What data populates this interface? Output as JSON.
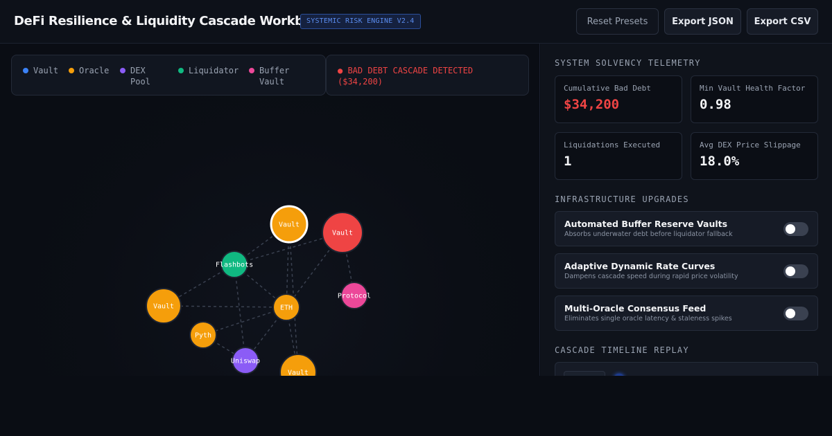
{
  "header": {
    "title": "DeFi Resilience & Liquidity Cascade Workbench",
    "badge": "SYSTEMIC RISK ENGINE V2.4",
    "buttons": {
      "reset": "Reset Presets",
      "export_json": "Export JSON",
      "export_csv": "Export CSV"
    }
  },
  "legend": {
    "items": [
      {
        "label": "Vault",
        "color": "#3b82f6"
      },
      {
        "label": "Oracle",
        "color": "#f59e0b"
      },
      {
        "label": "DEX\nPool",
        "color": "#8b5cf6"
      },
      {
        "label": "Liquidator",
        "color": "#10b981"
      },
      {
        "label": "Buffer\nVault",
        "color": "#ec4899"
      }
    ]
  },
  "alert": {
    "text": "● BAD DEBT CASCADE DETECTED ($34,200)",
    "color": "#ef4444"
  },
  "graph": {
    "nodes": [
      {
        "id": "vault-top",
        "label": "Vault",
        "color": "#f59e0b",
        "highlighted": true
      },
      {
        "id": "vault-red",
        "label": "Vault",
        "color": "#ef4444",
        "highlighted": false
      },
      {
        "id": "flashbots",
        "label": "Flashbots",
        "color": "#10b981",
        "highlighted": false
      },
      {
        "id": "protocol",
        "label": "Protocol",
        "color": "#ec4899",
        "highlighted": false
      },
      {
        "id": "vault-left",
        "label": "Vault",
        "color": "#f59e0b",
        "highlighted": false
      },
      {
        "id": "eth",
        "label": "ETH",
        "color": "#f59e0b",
        "highlighted": false
      },
      {
        "id": "pyth",
        "label": "Pyth",
        "color": "#f59e0b",
        "highlighted": false
      },
      {
        "id": "uniswap",
        "label": "Uniswap",
        "color": "#8b5cf6",
        "highlighted": false
      },
      {
        "id": "vault-bottom",
        "label": "Vault",
        "color": "#f59e0b",
        "highlighted": false
      }
    ],
    "edges": [
      [
        "flashbots",
        "vault-top"
      ],
      [
        "flashbots",
        "vault-red"
      ],
      [
        "flashbots",
        "vault-left"
      ],
      [
        "flashbots",
        "eth"
      ],
      [
        "flashbots",
        "uniswap"
      ],
      [
        "vault-top",
        "eth"
      ],
      [
        "vault-top",
        "vault-bottom"
      ],
      [
        "vault-red",
        "eth"
      ],
      [
        "vault-red",
        "protocol"
      ],
      [
        "vault-left",
        "eth"
      ],
      [
        "eth",
        "pyth"
      ],
      [
        "eth",
        "uniswap"
      ],
      [
        "eth",
        "vault-bottom"
      ],
      [
        "pyth",
        "uniswap"
      ]
    ]
  },
  "telemetry": {
    "title": "SYSTEM SOLVENCY TELEMETRY",
    "metrics": [
      {
        "label": "Cumulative Bad Debt",
        "value": "$34,200"
      },
      {
        "label": "Min Vault Health Factor",
        "value": "0.98"
      },
      {
        "label": "Liquidations Executed",
        "value": "1"
      },
      {
        "label": "Avg DEX Price Slippage",
        "value": "18.0%"
      }
    ]
  },
  "upgrades": {
    "title": "INFRASTRUCTURE UPGRADES",
    "items": [
      {
        "title": "Automated Buffer Reserve Vaults",
        "desc": "Absorbs underwater debt before liquidator fallback",
        "enabled": false
      },
      {
        "title": "Adaptive Dynamic Rate Curves",
        "desc": "Dampens cascade speed during rapid price volatility",
        "enabled": false
      },
      {
        "title": "Multi-Oracle Consensus Feed",
        "desc": "Eliminates single oracle latency & staleness spikes",
        "enabled": false
      }
    ]
  },
  "timeline": {
    "title": "CASCADE TIMELINE REPLAY"
  },
  "colors": {
    "accent": "#5b8def",
    "danger": "#ef4444",
    "background": "#0a0d14"
  }
}
